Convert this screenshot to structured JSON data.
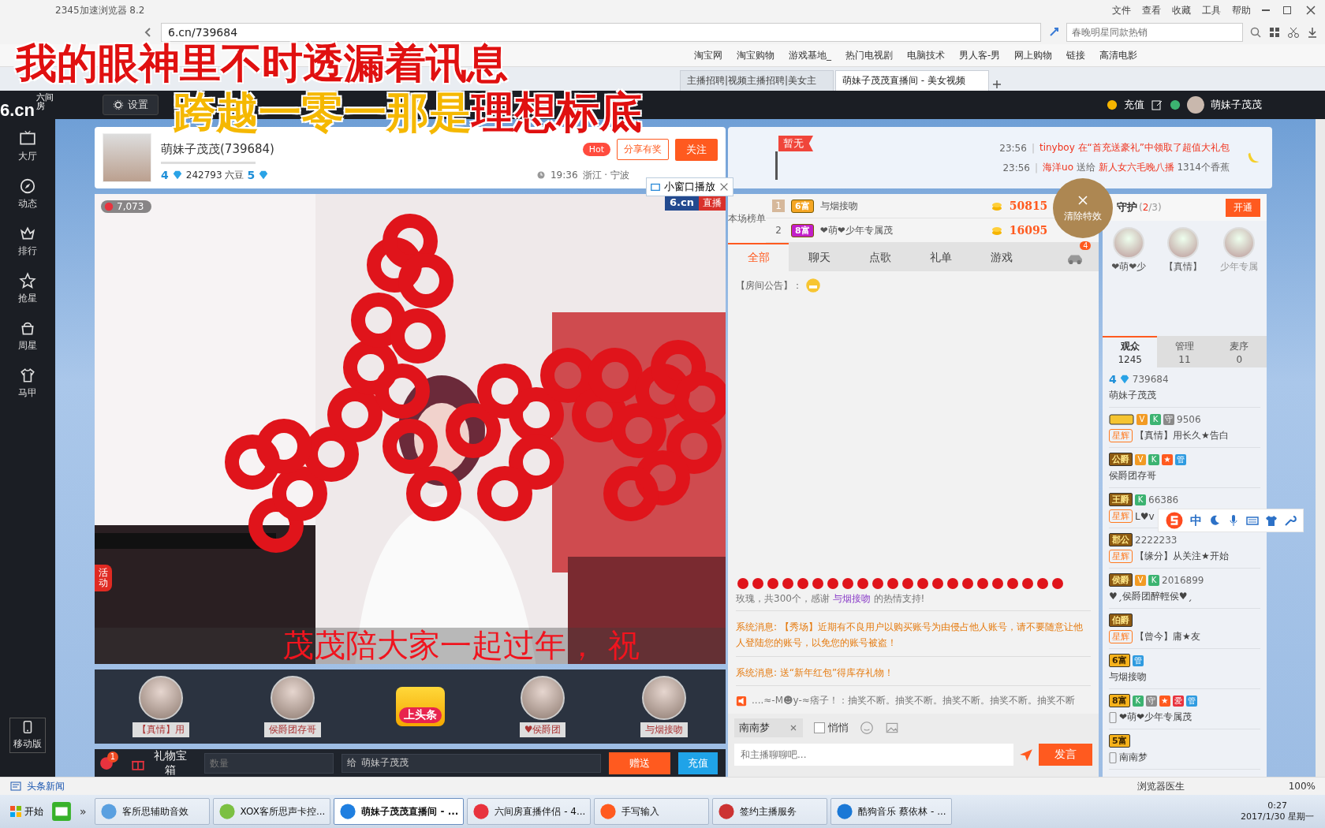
{
  "browser": {
    "title": "2345加速浏览器 8.2",
    "menu": [
      "文件",
      "查看",
      "收藏",
      "工具",
      "帮助"
    ],
    "url": "6.cn/739684",
    "search": {
      "placeholder": "春晚明星同款热销"
    },
    "bookmarks": [
      "淘宝网",
      "淘宝购物",
      "游戏基地_",
      "热门电视剧",
      "电脑技术",
      "男人客-男",
      "网上购物",
      "链接",
      "高清电影"
    ],
    "tabs": [
      {
        "label": "主播招聘|视频主播招聘|美女主",
        "selected": false
      },
      {
        "label": "萌妹子茂茂直播间 - 美女视频",
        "selected": true
      }
    ]
  },
  "lyrics": [
    {
      "rest": "我的眼神里不时透漏着讯息"
    },
    {
      "sung": "跨越一零一那是",
      "rest": "理想标底"
    }
  ],
  "header": {
    "logo": "6.cn",
    "logo_sub": "六间房",
    "settings": "设置",
    "recharge": "充值",
    "user": "萌妹子茂茂"
  },
  "sidebar": {
    "items": [
      "大厅",
      "动态",
      "排行",
      "抢星",
      "周星",
      "马甲"
    ],
    "mobile": "移动版"
  },
  "streamer": {
    "name": "萌妹子茂茂(739684)",
    "level": "4",
    "beans": "242793 六豆",
    "level2": "5",
    "hot": "Hot",
    "share": "分享有奖",
    "follow": "关注",
    "time": "19:36",
    "location": "浙江 · 宁波",
    "mini": "小窗口播放"
  },
  "video": {
    "viewers": "7,073",
    "brand": "6.cn",
    "live": "直播",
    "activity": "活动",
    "caption": "茂茂陪大家一起过年， 祝"
  },
  "stars": [
    {
      "kind": "avatar",
      "name": "【真情】用"
    },
    {
      "kind": "avatar",
      "name": "侯爵团存哥"
    },
    {
      "kind": "headline",
      "name": "上头条"
    },
    {
      "kind": "avatar",
      "name": "♥侯爵团"
    },
    {
      "kind": "avatar",
      "name": "与烟接吻"
    }
  ],
  "gift_bar": {
    "count": "1",
    "box": "礼物宝箱",
    "quantity_placeholder": "数量",
    "to": "给",
    "recipient": "萌妹子茂茂",
    "send": "赠送",
    "recharge": "充值"
  },
  "news": {
    "flag": "暂无",
    "lines": [
      {
        "time": "23:56",
        "sep": "|",
        "parts": [
          {
            "text": "tinyboy 在“首充送豪礼”中领取了超值大礼包",
            "hl": true
          }
        ]
      },
      {
        "time": "23:56",
        "sep": "|",
        "parts": [
          {
            "text": "海洋uo",
            "hl": true
          },
          {
            "text": " 送给 ",
            "hl": false
          },
          {
            "text": "新人女六毛晚八播",
            "hl": true
          },
          {
            "text": " 1314个香蕉",
            "hl": false
          }
        ]
      }
    ]
  },
  "ranking": {
    "label": "本场榜单",
    "rows": [
      {
        "rank": "1",
        "badge": "6富",
        "color": "#f5a623",
        "name": "与烟接吻",
        "score": "50815"
      },
      {
        "rank": "2",
        "badge": "8富",
        "color": "#c21fc9",
        "name": "❤萌❤少年专属茂",
        "score": "16095"
      }
    ]
  },
  "clear_effects": "清除特效",
  "chat_tabs": [
    {
      "label": "全部",
      "selected": true
    },
    {
      "label": "聊天",
      "selected": false
    },
    {
      "label": "点歌",
      "selected": false
    },
    {
      "label": "礼单",
      "selected": false
    },
    {
      "label": "游戏",
      "selected": false
    }
  ],
  "car_count": "4",
  "messages": [
    {
      "kind": "notice",
      "text": "【房间公告】："
    },
    {
      "kind": "gift",
      "before": "玫瑰，共300个，感谢 ",
      "user": "与烟接吻",
      "after": " 的热情支持!"
    },
    {
      "kind": "system",
      "text": "系统消息: 【秀场】近期有不良用户以购买账号为由侵占他人账号，请不要随意让他人登陆您的账号，以免您的账号被盗！"
    },
    {
      "kind": "system",
      "text": "系统消息: 送“新年红包”得库存礼物！"
    },
    {
      "kind": "broadcast",
      "text": "....≈-M☻y-≈痞子！：抽奖不断。抽奖不断。抽奖不断。抽奖不断。抽奖不断"
    }
  ],
  "chat_input": {
    "target": "南南梦",
    "whisper": {
      "label": "悄悄",
      "checked": false
    },
    "placeholder": "和主播聊聊吧...",
    "send": "发言"
  },
  "guard": {
    "title": "守护",
    "count_parts": [
      {
        "text": "(",
        "hl": false
      },
      {
        "text": "2",
        "hl": true
      },
      {
        "text": "/3)",
        "hl": false
      }
    ],
    "open": "开通",
    "members": [
      "❤萌❤少",
      "【真情】",
      "少年专属"
    ]
  },
  "audience_tabs": [
    {
      "label": "观众",
      "count": "1245",
      "selected": true
    },
    {
      "label": "管理",
      "count": "11",
      "selected": false
    },
    {
      "label": "麦序",
      "count": "0",
      "selected": false
    }
  ],
  "users": [
    {
      "level": "4",
      "number": "739684",
      "name": "萌妹子茂茂"
    },
    {
      "tags": [
        "V",
        "K",
        "守"
      ],
      "number": "9506",
      "star": "星辉",
      "name": "【真情】用长久★告白"
    },
    {
      "rank": "公爵",
      "tags": [
        "V",
        "K",
        "★",
        "管"
      ],
      "name": "侯爵团存哥"
    },
    {
      "rank": "王爵",
      "tags": [
        "K"
      ],
      "number": "66386",
      "star": "星辉",
      "name": "L♥v"
    },
    {
      "rank": "郡公",
      "number": "2222233",
      "star": "星辉",
      "name": "【缘分】从关注★开始"
    },
    {
      "rank": "侯爵",
      "tags": [
        "V",
        "K"
      ],
      "number": "2016899",
      "name": "♥ˏ侯爵团醉輕侯♥ˏ"
    },
    {
      "rank": "伯爵",
      "star": "星辉",
      "name": "【曾今】庸★友"
    },
    {
      "rank": "6富",
      "tags": [
        "管"
      ],
      "name": "与烟接吻"
    },
    {
      "rank": "8富",
      "tags": [
        "K",
        "守",
        "★",
        "爱",
        "管"
      ],
      "phone": true,
      "name": "❤萌❤少年专属茂"
    },
    {
      "rank": "5富",
      "phone": true,
      "name": "南南梦"
    }
  ],
  "ime": {
    "mode": "中"
  },
  "status_bar": {
    "news": "头条新闻",
    "doctor": "浏览器医生",
    "zoom": "100%"
  },
  "taskbar": {
    "start": "开始",
    "more": "»",
    "items": [
      {
        "label": "客所思辅助音效",
        "selected": false
      },
      {
        "label": "XOX客所思声卡控...",
        "selected": false
      },
      {
        "label": "萌妹子茂茂直播间 - ...",
        "selected": true
      },
      {
        "label": "六间房直播伴侣 - 4...",
        "selected": false
      },
      {
        "label": "手写输入",
        "selected": false
      },
      {
        "label": "签约主播服务",
        "selected": false
      },
      {
        "label": "酷狗音乐 蔡依林 - ...",
        "selected": false
      }
    ],
    "time": "0:27",
    "date": "2017/1/30 星期一"
  }
}
